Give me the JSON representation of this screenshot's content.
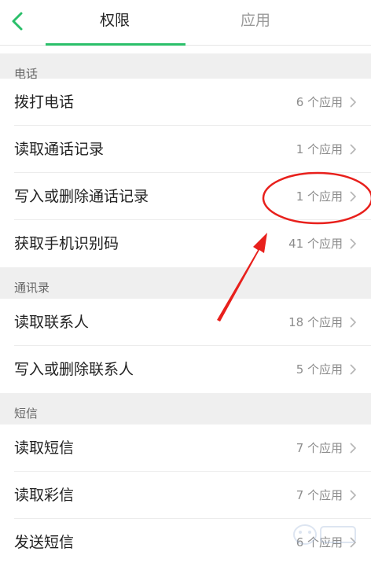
{
  "header": {
    "tabs": [
      {
        "label": "权限",
        "active": true
      },
      {
        "label": "应用",
        "active": false
      }
    ],
    "accent_color": "#2bbf6a"
  },
  "sections": [
    {
      "title": "电话",
      "items": [
        {
          "label": "拨打电话",
          "count": "6 个应用"
        },
        {
          "label": "读取通话记录",
          "count": "1 个应用"
        },
        {
          "label": "写入或删除通话记录",
          "count": "1 个应用"
        },
        {
          "label": "获取手机识别码",
          "count": "41 个应用"
        }
      ]
    },
    {
      "title": "通讯录",
      "items": [
        {
          "label": "读取联系人",
          "count": "18 个应用"
        },
        {
          "label": "写入或删除联系人",
          "count": "5 个应用"
        }
      ]
    },
    {
      "title": "短信",
      "items": [
        {
          "label": "读取短信",
          "count": "7 个应用"
        },
        {
          "label": "读取彩信",
          "count": "7 个应用"
        },
        {
          "label": "发送短信",
          "count": "6 个应用"
        }
      ]
    }
  ],
  "icons": {
    "back": "chevron-left-icon",
    "row_arrow": "chevron-right-icon"
  },
  "annotation_color": "#e8201c"
}
